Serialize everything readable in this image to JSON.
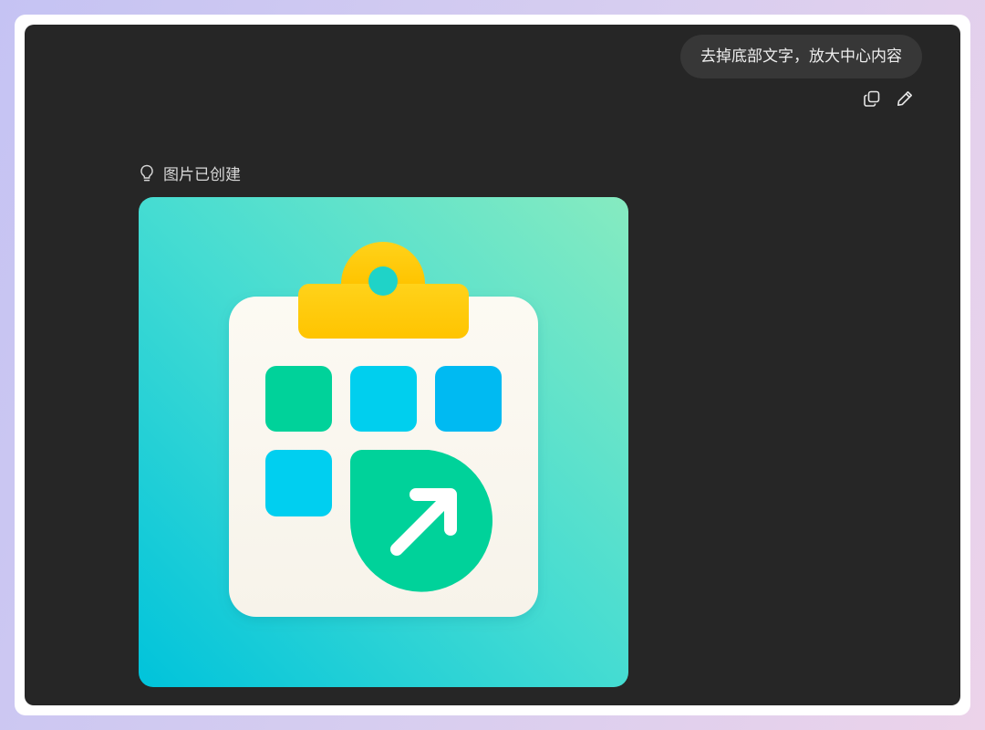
{
  "user_message": {
    "text": "去掉底部文字，放大中心内容"
  },
  "message_actions": {
    "icons": [
      "copy-icon",
      "edit-icon"
    ]
  },
  "result": {
    "status_icon": "lightbulb-icon",
    "status_text": "图片已创建"
  },
  "image": {
    "subject": "clipboard-calendar-arrow-app-icon",
    "colors": {
      "bg_top_right": "#86ebc0",
      "bg_bottom_left": "#00c3db",
      "board": "#faf7ef",
      "clip": "#ffcc00",
      "green": "#00d29a",
      "cyan": "#00cff0",
      "blue": "#00baf2"
    }
  }
}
